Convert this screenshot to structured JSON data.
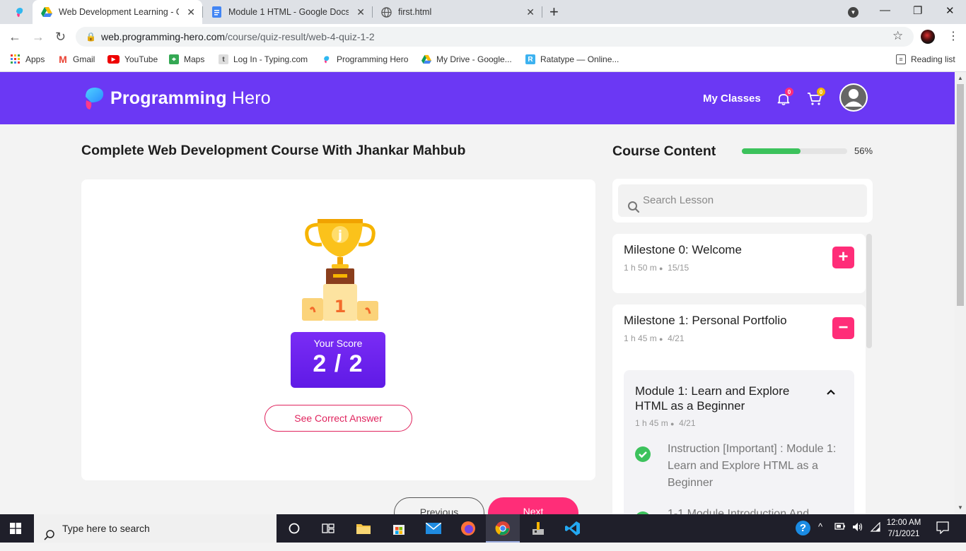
{
  "browser": {
    "tabs": [
      {
        "title": "Web Development Learning - Go",
        "active": true,
        "icon": "google-drive-icon"
      },
      {
        "title": "Module 1 HTML - Google Docs",
        "icon": "google-docs-icon"
      },
      {
        "title": "first.html",
        "icon": "globe-icon"
      }
    ],
    "url_host": "web.programming-hero.com",
    "url_path": "/course/quiz-result/web-4-quiz-1-2",
    "bookmarks": [
      {
        "label": "Apps",
        "icon": "apps-grid-icon"
      },
      {
        "label": "Gmail",
        "icon": "gmail-icon"
      },
      {
        "label": "YouTube",
        "icon": "youtube-icon"
      },
      {
        "label": "Maps",
        "icon": "maps-icon"
      },
      {
        "label": "Log In - Typing.com",
        "icon": "typing-icon"
      },
      {
        "label": "Programming Hero",
        "icon": "programming-hero-icon"
      },
      {
        "label": "My Drive - Google...",
        "icon": "google-drive-icon"
      },
      {
        "label": "Ratatype — Online...",
        "icon": "ratatype-icon"
      }
    ],
    "reading_list": "Reading list"
  },
  "header": {
    "brand_bold": "Programming",
    "brand_light": " Hero",
    "my_classes": "My Classes",
    "notifications_count": "0",
    "cart_count": "0"
  },
  "course": {
    "title": "Complete Web Development Course With Jhankar Mahbub"
  },
  "result": {
    "score_label": "Your Score",
    "score_value": "2 / 2",
    "trophy_letter": "j",
    "podium_number": "1",
    "see_answer": "See Correct Answer",
    "previous": "Previous",
    "next": "Next"
  },
  "sidebar": {
    "title": "Course Content",
    "progress_percent": 56,
    "progress_text": "56%",
    "search_placeholder": "Search Lesson",
    "milestones": [
      {
        "name": "Milestone 0: Welcome",
        "duration": "1 h 50 m",
        "progress": "15/15",
        "toggle": "+"
      },
      {
        "name": "Milestone 1: Personal Portfolio",
        "duration": "1 h 45 m",
        "progress": "4/21",
        "toggle": "−"
      }
    ],
    "module": {
      "title": "Module 1: Learn and Explore HTML as a Beginner",
      "duration": "1 h 45 m",
      "progress": "4/21",
      "lessons": [
        "Instruction [Important] : Module 1: Learn and Explore HTML as a Beginner",
        "1-1 Module Introduction And..."
      ]
    }
  },
  "taskbar": {
    "search_placeholder": "Type here to search",
    "time": "12:00 AM",
    "date": "7/1/2021"
  },
  "colors": {
    "brand_purple": "#6b38f4",
    "accent_pink": "#ff2d78",
    "success_green": "#3cc25c",
    "score_purple": "#6a22ee"
  }
}
